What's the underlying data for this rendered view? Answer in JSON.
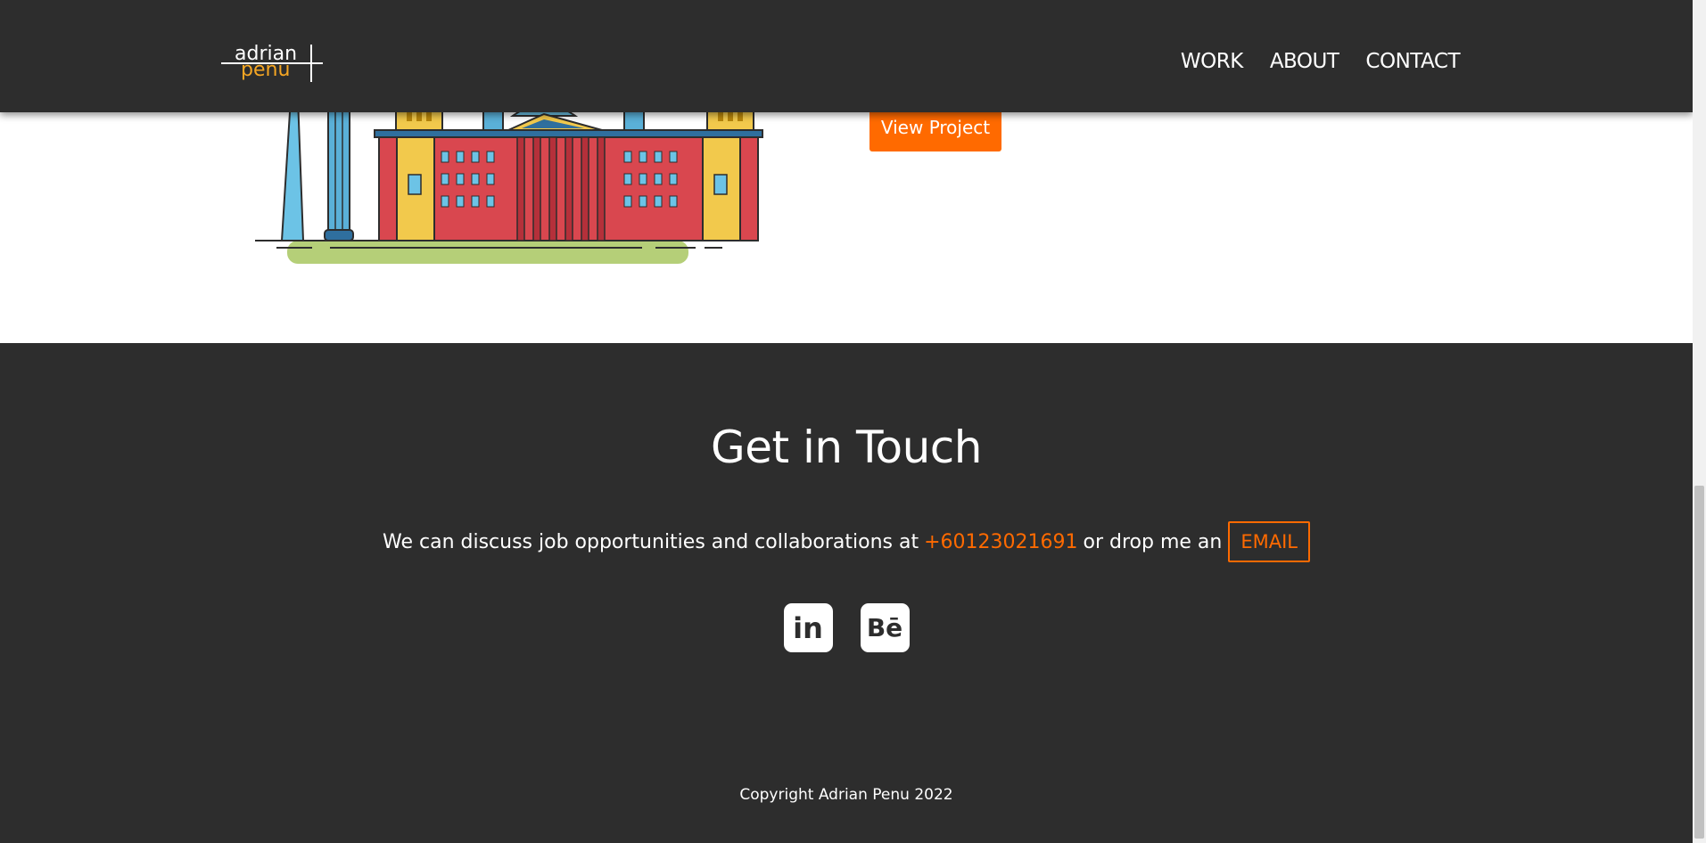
{
  "header": {
    "logo": {
      "line1": "adrian",
      "line2": "penu"
    },
    "nav": [
      {
        "label": "WORK"
      },
      {
        "label": "ABOUT"
      },
      {
        "label": "CONTACT"
      }
    ]
  },
  "project": {
    "view_button_label": "View Project"
  },
  "contact": {
    "title": "Get in Touch",
    "message_prefix": "We can discuss job opportunities and collaborations at",
    "phone": "+60123021691",
    "message_middle": "or drop me an",
    "email_label": "EMAIL",
    "socials": [
      {
        "name": "linkedin",
        "glyph": "in"
      },
      {
        "name": "behance",
        "glyph": "Bē"
      }
    ],
    "copyright": "Copyright Adrian Penu 2022"
  },
  "colors": {
    "accent": "#ff6a00",
    "logo_accent": "#f5a623",
    "dark": "#2d2d2d",
    "white": "#ffffff"
  }
}
